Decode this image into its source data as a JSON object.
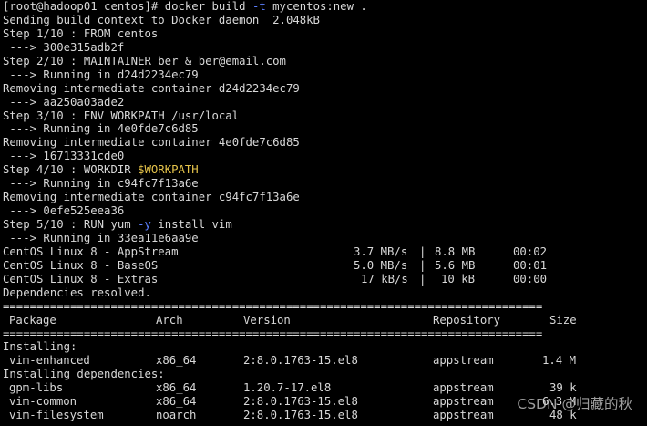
{
  "terminal": {
    "command": {
      "prompt": "[root@hadoop01 centos]# ",
      "cmd": "docker build ",
      "flag": "-t",
      "args": " mycentos:new ."
    },
    "lines_a": [
      "Sending build context to Docker daemon  2.048kB",
      "Step 1/10 : FROM centos",
      " ---> 300e315adb2f",
      "Step 2/10 : MAINTAINER ber & ber@email.com",
      " ---> Running in d24d2234ec79",
      "Removing intermediate container d24d2234ec79",
      " ---> aa250a03ade2",
      "Step 3/10 : ENV WORKPATH /usr/local",
      " ---> Running in 4e0fde7c6d85",
      "Removing intermediate container 4e0fde7c6d85",
      " ---> 16713331cde0"
    ],
    "step4": {
      "prefix": "Step 4/10 : WORKDIR ",
      "var": "$WORKPATH"
    },
    "lines_b": [
      " ---> Running in c94fc7f13a6e",
      "Removing intermediate container c94fc7f13a6e",
      " ---> 0efe525eea36"
    ],
    "step5": {
      "prefix": "Step 5/10 : RUN yum ",
      "flag": "-y",
      "suffix": " install vim"
    },
    "running_line": " ---> Running in 33ea11e6aa9e",
    "downloads": [
      {
        "name": "CentOS Linux 8 - AppStream",
        "speed": "3.7 MB/s",
        "size": "8.8 MB",
        "time": "00:02"
      },
      {
        "name": "CentOS Linux 8 - BaseOS",
        "speed": "5.0 MB/s",
        "size": "5.6 MB",
        "time": "00:01"
      },
      {
        "name": "CentOS Linux 8 - Extras",
        "speed": "17 kB/s",
        "size": "10 kB",
        "time": "00:00"
      }
    ],
    "deps_resolved": "Dependencies resolved.",
    "rule": "================================================================================",
    "table_headers": {
      "package": "Package",
      "arch": "Arch",
      "version": "Version",
      "repository": "Repository",
      "size": "Size"
    },
    "installing_label": "Installing:",
    "installing_rows": [
      {
        "package": "vim-enhanced",
        "arch": "x86_64",
        "version": "2:8.0.1763-15.el8",
        "repository": "appstream",
        "size": "1.4 M"
      }
    ],
    "deps_label": "Installing dependencies:",
    "deps_rows": [
      {
        "package": "gpm-libs",
        "arch": "x86_64",
        "version": "1.20.7-17.el8",
        "repository": "appstream",
        "size": "39 k"
      },
      {
        "package": "vim-common",
        "arch": "x86_64",
        "version": "2:8.0.1763-15.el8",
        "repository": "appstream",
        "size": "6.3 M"
      },
      {
        "package": "vim-filesystem",
        "arch": "noarch",
        "version": "2:8.0.1763-15.el8",
        "repository": "appstream",
        "size": "48 k"
      }
    ]
  },
  "watermark": "CSDN @归藏的秋",
  "colors": {
    "background": "#000000",
    "text": "#d8d8d8",
    "variable": "#e5c34a",
    "flag": "#5b7fff"
  }
}
